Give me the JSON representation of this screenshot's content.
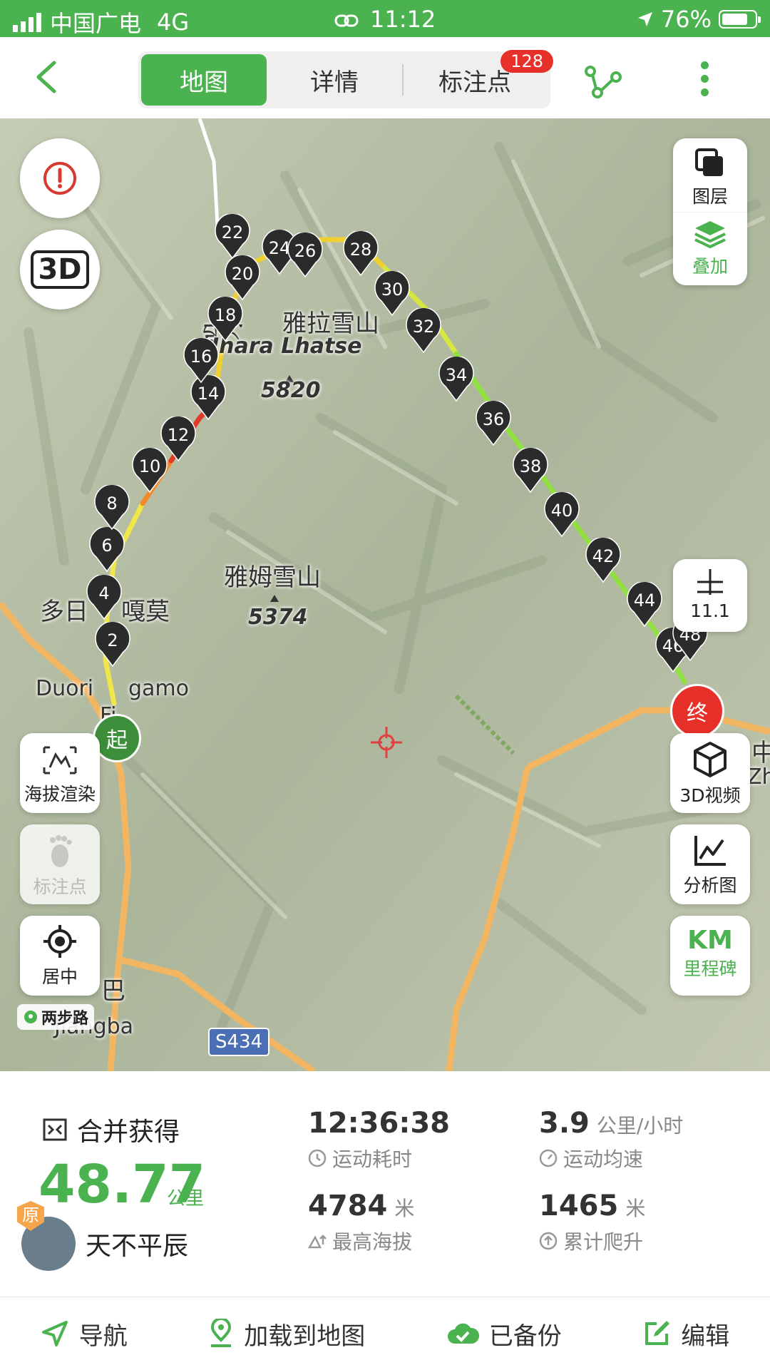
{
  "status_bar": {
    "carrier": "中国广电",
    "network": "4G",
    "time": "11:12",
    "battery": "76%"
  },
  "header": {
    "tabs": [
      {
        "label": "地图",
        "active": true
      },
      {
        "label": "详情",
        "active": false
      },
      {
        "label": "标注点",
        "active": false,
        "badge": "128"
      }
    ]
  },
  "map": {
    "labels": {
      "peak1_tibetan": "བྷ་ར་",
      "peak1_cn": "雅拉雪山",
      "peak1_en": "Jhara Lhatse",
      "peak1_alt": "5820",
      "peak2_cn": "雅姆雪山",
      "peak2_alt": "5374",
      "town1_cn": "多日",
      "town1_cn2": "嘎莫",
      "town1_en": "Duori",
      "town1_en2": "gamo",
      "town1_f": "Fi",
      "town2_cn": "巴",
      "town2_en": "Jiangba",
      "road": "S434",
      "edge_cn": "中",
      "edge_en": "Zh"
    },
    "waypoints": [
      "2",
      "4",
      "6",
      "8",
      "10",
      "12",
      "14",
      "16",
      "18",
      "20",
      "22",
      "24",
      "26",
      "28",
      "30",
      "32",
      "34",
      "36",
      "38",
      "40",
      "42",
      "44",
      "46",
      "48"
    ],
    "start_label": "起",
    "end_label": "终",
    "controls": {
      "layer_label": "图层",
      "overlay_label": "叠加",
      "zoom_level": "11.1",
      "video_label": "3D视频",
      "analysis_label": "分析图",
      "km_label": "KM",
      "milestone_label": "里程碑",
      "elevation_label": "海拔渲染",
      "marker_label": "标注点",
      "center_label": "居中",
      "three_d": "3D"
    },
    "logo": "两步路"
  },
  "stats": {
    "merge_label": "合并获得",
    "distance": "48.77",
    "distance_unit": "公里",
    "duration": "12:36:38",
    "duration_label": "运动耗时",
    "speed": "3.9",
    "speed_unit": "公里/小时",
    "speed_label": "运动均速",
    "max_alt": "4784",
    "max_alt_unit": "米",
    "max_alt_label": "最高海拔",
    "climb": "1465",
    "climb_unit": "米",
    "climb_label": "累计爬升",
    "user_badge": "原",
    "username": "天不平辰"
  },
  "bottom_bar": {
    "navigate": "导航",
    "load_map": "加载到地图",
    "backed_up": "已备份",
    "edit": "编辑"
  },
  "colors": {
    "accent": "#4ab24e",
    "badge": "#e8302a",
    "pin": "#2b2b2b",
    "road": "#f0b35a"
  }
}
